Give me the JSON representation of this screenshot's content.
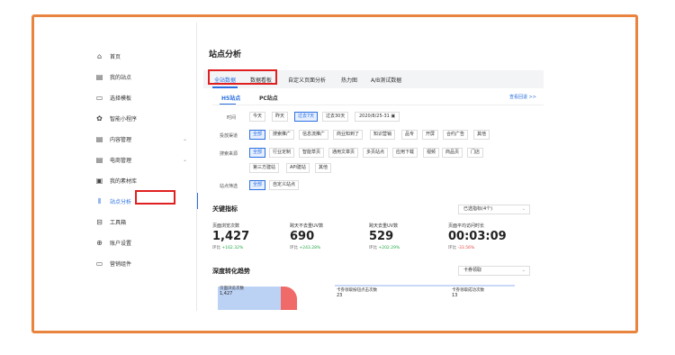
{
  "sidebar": {
    "items": [
      {
        "label": "首页",
        "icon": "home-icon",
        "glyph": "⌂"
      },
      {
        "label": "我的站点",
        "icon": "site-icon",
        "glyph": "▤"
      },
      {
        "label": "选择模板",
        "icon": "template-icon",
        "glyph": "▭"
      },
      {
        "label": "智能小程序",
        "icon": "miniapp-icon",
        "glyph": "✿"
      },
      {
        "label": "内容管理",
        "icon": "content-icon",
        "glyph": "▤"
      },
      {
        "label": "电商管理",
        "icon": "ecommerce-icon",
        "glyph": "▤"
      },
      {
        "label": "我的素材库",
        "icon": "material-icon",
        "glyph": "▣"
      },
      {
        "label": "站点分析",
        "icon": "chart-icon",
        "glyph": "⫴"
      },
      {
        "label": "工具箱",
        "icon": "toolbox-icon",
        "glyph": "⊟"
      },
      {
        "label": "账户设置",
        "icon": "settings-icon",
        "glyph": "⊕"
      },
      {
        "label": "营销组件",
        "icon": "marketing-icon",
        "glyph": "▭"
      }
    ],
    "chevron": "⌄"
  },
  "page": {
    "title": "站点分析"
  },
  "tabs": [
    "全站数据",
    "数据看板",
    "自定义页面分析",
    "热力图",
    "A/B测试数据"
  ],
  "subtabs": [
    "H5站点",
    "PC站点"
  ],
  "upgrade_link": "查看回退 >>",
  "filters": {
    "time": {
      "label": "时间",
      "options": [
        "今天",
        "昨天",
        "过去7天",
        "过去30天"
      ],
      "date": "2020/8/25-31"
    },
    "channel": {
      "label": "投放渠道",
      "options": [
        "全部",
        "搜索推广",
        "信息流推广",
        "商业知到了",
        "知识营销",
        "品专",
        "开屏",
        "合约广告",
        "其他"
      ]
    },
    "source": {
      "label": "搜索来源",
      "row1": [
        "全部",
        "行业定制",
        "智能草页",
        "通用文章页",
        "多页站点",
        "应用下载",
        "视频",
        "商品页",
        "门店"
      ],
      "row2": [
        "第三方建站",
        "API建站",
        "其他"
      ]
    },
    "site": {
      "label": "站点筛选",
      "options": [
        "全部",
        "自定义站点"
      ]
    }
  },
  "key_metrics": {
    "title": "关键指标",
    "select": "已选指标(4个)",
    "cmp_label": "环比",
    "items": [
      {
        "label": "页面浏览次数",
        "value": "1,427",
        "change": "+162.32%",
        "trend": "up"
      },
      {
        "label": "跨天不去重UV数",
        "value": "690",
        "change": "+243.28%",
        "trend": "up"
      },
      {
        "label": "跨天去重UV数",
        "value": "529",
        "change": "+202.29%",
        "trend": "up"
      },
      {
        "label": "页面平均访问时长",
        "value": "00:03:09",
        "change": "-33.56%",
        "trend": "down"
      }
    ]
  },
  "conversion": {
    "title": "深度转化趋势",
    "select": "卡券领取",
    "columns": [
      {
        "label": "页面浏览次数",
        "value": "1,427"
      },
      {
        "label": "卡券领取按钮点击次数",
        "value": "23"
      },
      {
        "label": "卡券领取成功次数",
        "value": "13"
      }
    ]
  },
  "colors": {
    "accent": "#2b6fe0",
    "frame": "#e8843e",
    "highlight": "#e02020",
    "up": "#2aa84a",
    "down": "#e84a4a"
  }
}
